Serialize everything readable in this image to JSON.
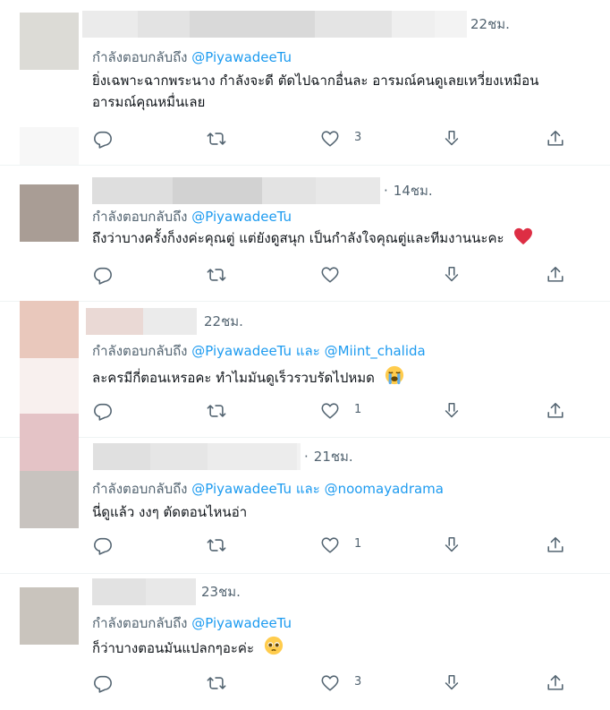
{
  "reply_prefix": "กำลังตอบกลับถึง",
  "and_word": "และ",
  "tweets": [
    {
      "time": "22ชม.",
      "mentions": [
        "@PiyawadeeTu"
      ],
      "text": [
        "ยิ่งเฉพาะฉากพระนาง กำลังจะดี ตัดไปฉากอื่นละ อารมณ์คนดูเลยเหวี่ยงเหมือน",
        "อารมณ์คุณหมื่นเลย"
      ],
      "like_count": "3",
      "emoji": null
    },
    {
      "time": "14ชม.",
      "mentions": [
        "@PiyawadeeTu"
      ],
      "text": [
        "ถึงว่าบางครั้งก็งงค่ะคุณตู่ แต่ยังดูสนุก เป็นกำลังใจคุณตู่และทีมงานนะคะ"
      ],
      "like_count": "",
      "emoji": "red-heart"
    },
    {
      "time": "22ชม.",
      "mentions": [
        "@PiyawadeeTu",
        "@Miint_chalida"
      ],
      "text": [
        "ละครมีกี่ตอนเหรอคะ ทำไมมันดูเร็วรวบรัดไปหมด"
      ],
      "like_count": "1",
      "emoji": "loudly-crying-face"
    },
    {
      "time": "21ชม.",
      "mentions": [
        "@PiyawadeeTu",
        "@noomayadrama"
      ],
      "text": [
        "นี่ดูแล้ว งงๆ ตัดตอนไหนอ่า"
      ],
      "like_count": "1",
      "emoji": null
    },
    {
      "time": "23ชม.",
      "mentions": [
        "@PiyawadeeTu"
      ],
      "text": [
        "ก็ว่าบางตอนมันแปลกๆอะค่ะ"
      ],
      "like_count": "3",
      "emoji": "pleading-face"
    }
  ],
  "colors": {
    "accent": "#1d9bf0",
    "secondary_text": "#536471",
    "divider": "#eff3f4",
    "heart": "#e0245e"
  }
}
